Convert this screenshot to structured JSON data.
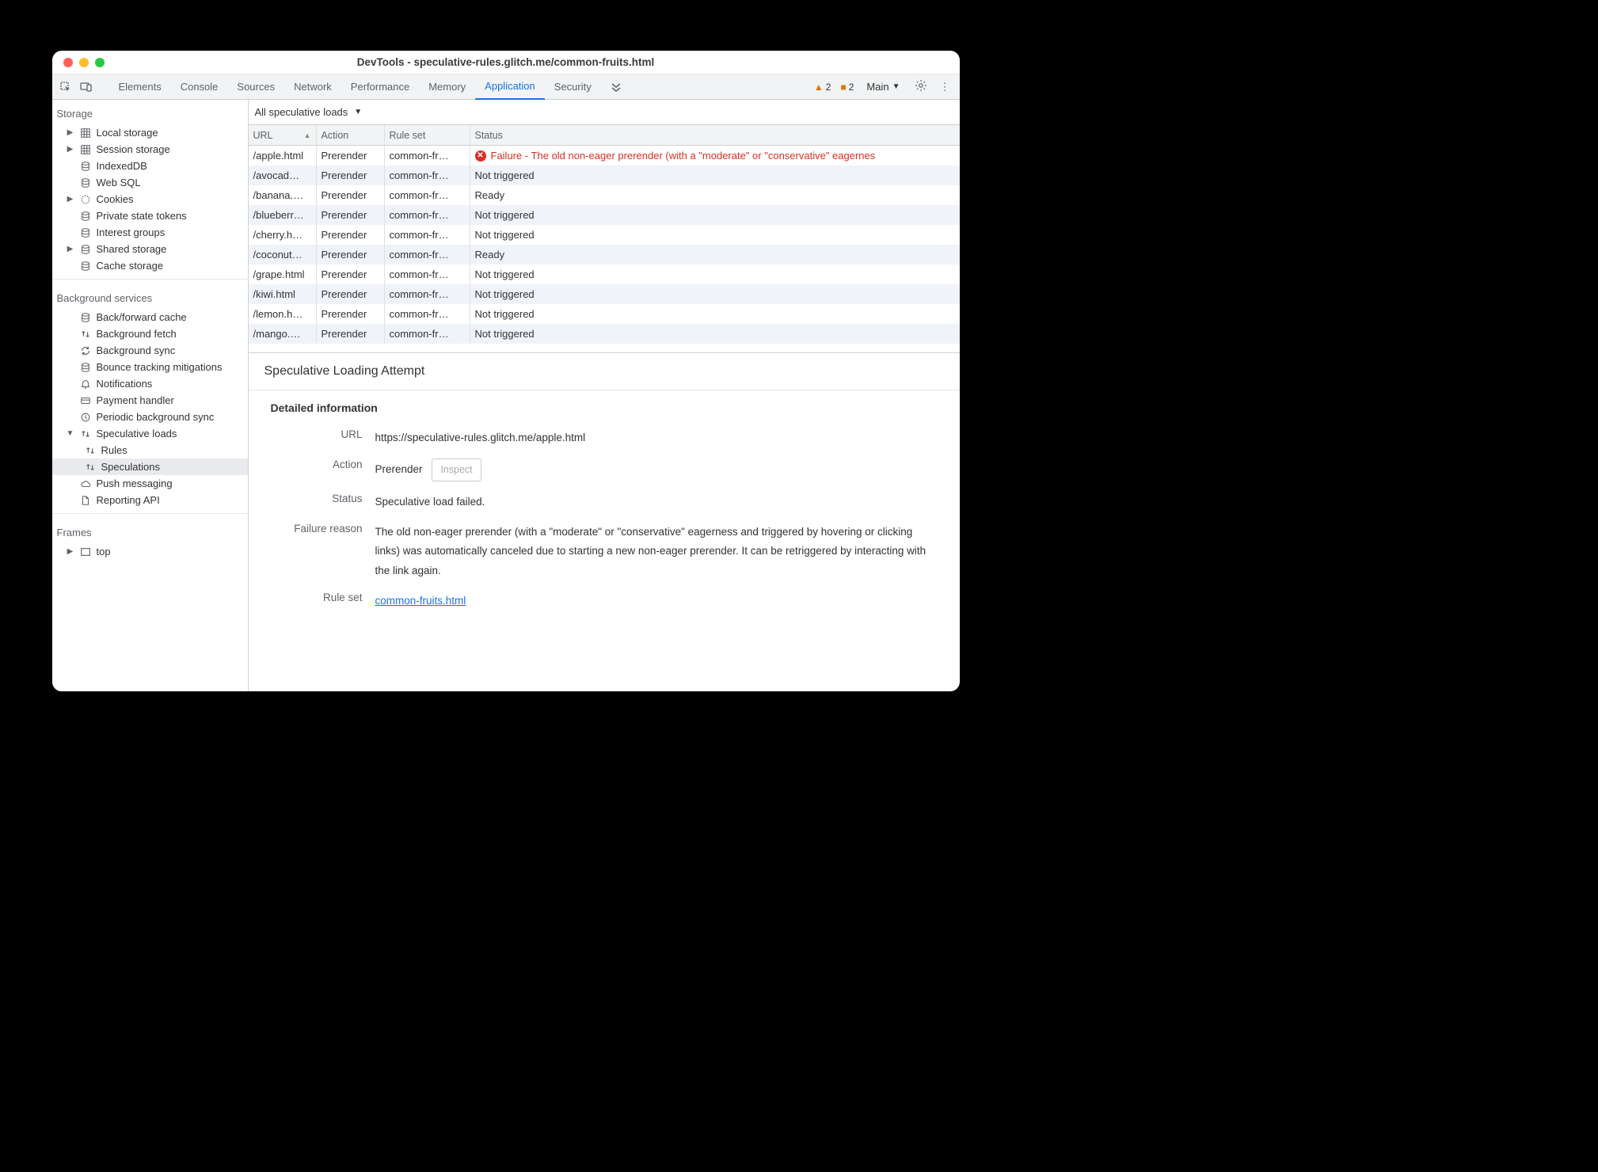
{
  "title": "DevTools - speculative-rules.glitch.me/common-fruits.html",
  "tabs": [
    "Elements",
    "Console",
    "Sources",
    "Network",
    "Performance",
    "Memory",
    "Application",
    "Security"
  ],
  "active_tab": "Application",
  "warn_triangle_count": "2",
  "warn_square_count": "2",
  "main_label": "Main",
  "sidebar": {
    "storage_title": "Storage",
    "storage_items": [
      {
        "label": "Local storage",
        "arrow": "▶",
        "icon": "grid"
      },
      {
        "label": "Session storage",
        "arrow": "▶",
        "icon": "grid"
      },
      {
        "label": "IndexedDB",
        "arrow": "",
        "icon": "db"
      },
      {
        "label": "Web SQL",
        "arrow": "",
        "icon": "db"
      },
      {
        "label": "Cookies",
        "arrow": "▶",
        "icon": "cookie"
      },
      {
        "label": "Private state tokens",
        "arrow": "",
        "icon": "db"
      },
      {
        "label": "Interest groups",
        "arrow": "",
        "icon": "db"
      },
      {
        "label": "Shared storage",
        "arrow": "▶",
        "icon": "db"
      },
      {
        "label": "Cache storage",
        "arrow": "",
        "icon": "db"
      }
    ],
    "bg_title": "Background services",
    "bg_items": [
      {
        "label": "Back/forward cache",
        "arrow": "",
        "icon": "db"
      },
      {
        "label": "Background fetch",
        "arrow": "",
        "icon": "updown"
      },
      {
        "label": "Background sync",
        "arrow": "",
        "icon": "sync"
      },
      {
        "label": "Bounce tracking mitigations",
        "arrow": "",
        "icon": "db"
      },
      {
        "label": "Notifications",
        "arrow": "",
        "icon": "bell"
      },
      {
        "label": "Payment handler",
        "arrow": "",
        "icon": "card"
      },
      {
        "label": "Periodic background sync",
        "arrow": "",
        "icon": "clock"
      },
      {
        "label": "Speculative loads",
        "arrow": "▼",
        "icon": "updown",
        "expanded": true
      },
      {
        "label": "Push messaging",
        "arrow": "",
        "icon": "cloud"
      },
      {
        "label": "Reporting API",
        "arrow": "",
        "icon": "doc"
      }
    ],
    "speculative_children": [
      {
        "label": "Rules",
        "icon": "updown",
        "selected": false
      },
      {
        "label": "Speculations",
        "icon": "updown",
        "selected": true
      }
    ],
    "frames_title": "Frames",
    "frames_item": {
      "label": "top",
      "arrow": "▶",
      "icon": "frame"
    }
  },
  "filter_label": "All speculative loads",
  "table": {
    "headers": {
      "url": "URL",
      "action": "Action",
      "ruleset": "Rule set",
      "status": "Status"
    },
    "rows": [
      {
        "url": "/apple.html",
        "action": "Prerender",
        "ruleset": "common-fr…",
        "status": "Failure - The old non-eager prerender (with a \"moderate\" or \"conservative\" eagernes",
        "fail": true
      },
      {
        "url": "/avocad…",
        "action": "Prerender",
        "ruleset": "common-fr…",
        "status": "Not triggered"
      },
      {
        "url": "/banana.…",
        "action": "Prerender",
        "ruleset": "common-fr…",
        "status": "Ready"
      },
      {
        "url": "/blueberr…",
        "action": "Prerender",
        "ruleset": "common-fr…",
        "status": "Not triggered"
      },
      {
        "url": "/cherry.h…",
        "action": "Prerender",
        "ruleset": "common-fr…",
        "status": "Not triggered"
      },
      {
        "url": "/coconut…",
        "action": "Prerender",
        "ruleset": "common-fr…",
        "status": "Ready"
      },
      {
        "url": "/grape.html",
        "action": "Prerender",
        "ruleset": "common-fr…",
        "status": "Not triggered"
      },
      {
        "url": "/kiwi.html",
        "action": "Prerender",
        "ruleset": "common-fr…",
        "status": "Not triggered"
      },
      {
        "url": "/lemon.h…",
        "action": "Prerender",
        "ruleset": "common-fr…",
        "status": "Not triggered"
      },
      {
        "url": "/mango.…",
        "action": "Prerender",
        "ruleset": "common-fr…",
        "status": "Not triggered"
      }
    ]
  },
  "detail": {
    "header": "Speculative Loading Attempt",
    "sub": "Detailed information",
    "url_k": "URL",
    "url_v": "https://speculative-rules.glitch.me/apple.html",
    "action_k": "Action",
    "action_v": "Prerender",
    "inspect": "Inspect",
    "status_k": "Status",
    "status_v": "Speculative load failed.",
    "reason_k": "Failure reason",
    "reason_v": "The old non-eager prerender (with a \"moderate\" or \"conservative\" eagerness and triggered by hovering or clicking links) was automatically canceled due to starting a new non-eager prerender. It can be retriggered by interacting with the link again.",
    "ruleset_k": "Rule set",
    "ruleset_v": "common-fruits.html"
  }
}
